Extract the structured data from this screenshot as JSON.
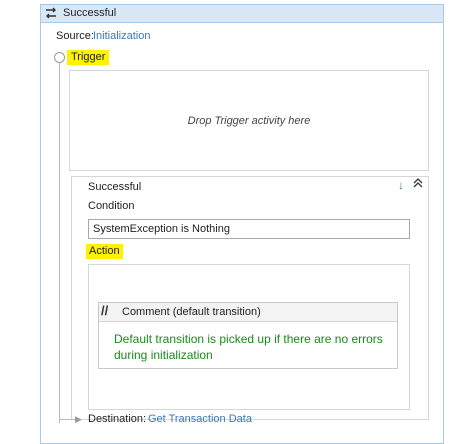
{
  "card": {
    "title": "Successful",
    "icon": "transition-icon"
  },
  "source": {
    "label": "Source:",
    "value": "Initialization"
  },
  "trigger": {
    "label": "Trigger",
    "drop_text": "Drop Trigger activity here"
  },
  "inner": {
    "title": "Successful",
    "down_glyph": "↓",
    "collapse_glyph": "⌃"
  },
  "condition": {
    "label": "Condition",
    "value": "SystemException is Nothing"
  },
  "action": {
    "label": "Action"
  },
  "comment": {
    "icon_glyph": "//",
    "title": "Comment (default transition)",
    "text": "Default transition is picked up if there are no errors during initialization"
  },
  "destination": {
    "label": "Destination:",
    "value": "Get Transaction Data"
  },
  "colors": {
    "highlight": "#fff200",
    "link": "#3a78b5",
    "comment_text": "#1a8a1a",
    "header_bg": "#d9e8f7"
  }
}
